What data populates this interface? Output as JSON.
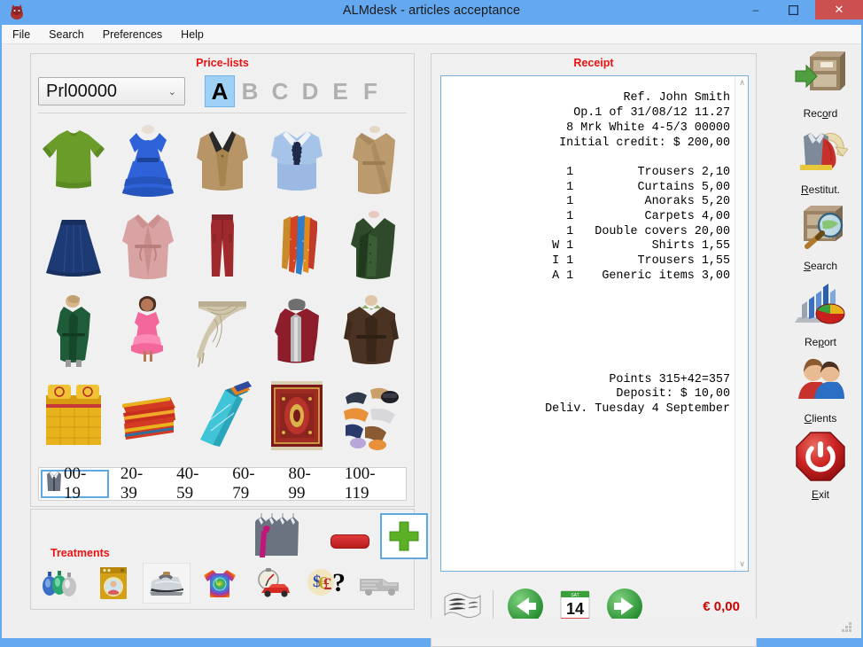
{
  "window": {
    "title": "ALMdesk - articles acceptance",
    "logo_icon": "almdesk-logo-icon",
    "minimize": "–",
    "maximize": "❐",
    "close": "✕",
    "titlebar_color": "#64a8f0",
    "close_color": "#cd5050"
  },
  "menubar": {
    "items": [
      {
        "label": "File"
      },
      {
        "label": "Search"
      },
      {
        "label": "Preferences"
      },
      {
        "label": "Help"
      }
    ]
  },
  "pricelists": {
    "title": "Price-lists",
    "title_color": "#ee1111",
    "combo_value": "Prl00000",
    "combo_arrow": "⌄",
    "letters": [
      "A",
      "B",
      "C",
      "D",
      "E",
      "F"
    ],
    "active_letter": "A",
    "articles": [
      {
        "name": "sweatshirt-green",
        "label": "Sweatshirt"
      },
      {
        "name": "dress-blue",
        "label": "Dress"
      },
      {
        "name": "jacket-tan",
        "label": "Jacket"
      },
      {
        "name": "shirt-blue-with-tie",
        "label": "Shirt"
      },
      {
        "name": "coat-camel",
        "label": "Coat"
      },
      {
        "name": "skirt-navy",
        "label": "Skirt"
      },
      {
        "name": "robe-pink",
        "label": "Robe"
      },
      {
        "name": "trousers-red",
        "label": "Trousers"
      },
      {
        "name": "ties-assorted",
        "label": "Ties"
      },
      {
        "name": "jacket-green",
        "label": "Jacket"
      },
      {
        "name": "raincoat-green",
        "label": "Raincoat"
      },
      {
        "name": "child-dress-pink",
        "label": "Child dress"
      },
      {
        "name": "curtain-beige",
        "label": "Curtains"
      },
      {
        "name": "anorak-red",
        "label": "Anoraks"
      },
      {
        "name": "leather-coat-brown",
        "label": "Leather coat"
      },
      {
        "name": "bed-covers-yellow",
        "label": "Double covers"
      },
      {
        "name": "blankets-red-folded",
        "label": "Blankets"
      },
      {
        "name": "towels-turquoise",
        "label": "Towels"
      },
      {
        "name": "carpet-persian",
        "label": "Carpets"
      },
      {
        "name": "accessories-assorted",
        "label": "Generic items"
      }
    ],
    "ranges": [
      {
        "label": "00-19",
        "icon": "suit-icon",
        "active": true
      },
      {
        "label": "20-39",
        "active": false
      },
      {
        "label": "40-59",
        "active": false
      },
      {
        "label": "60-79",
        "active": false
      },
      {
        "label": "80-99",
        "active": false
      },
      {
        "label": "100-119",
        "active": false
      }
    ]
  },
  "treatments": {
    "label": "Treatments",
    "label_color": "#ee1111",
    "suits_icon": "suits-rack-icon",
    "minus_label": "−",
    "plus_label": "+",
    "items": [
      {
        "name": "dyeing-icon",
        "label": "Dyeing"
      },
      {
        "name": "washing-machine-icon",
        "label": "Washing"
      },
      {
        "name": "ironing-icon",
        "label": "Ironing"
      },
      {
        "name": "tie-dye-shirt-icon",
        "label": "Colour"
      },
      {
        "name": "express-timer-icon",
        "label": "Express"
      },
      {
        "name": "currency-question-icon",
        "label": "Price query"
      },
      {
        "name": "delivery-van-icon",
        "label": "Delivery"
      }
    ]
  },
  "receipt": {
    "title": "Receipt",
    "title_color": "#ee1111",
    "header": [
      "Ref. John Smith",
      "Op.1 of 31/08/12 11.27",
      "8 Mrk White 4-5/3 00000",
      "Initial credit: $ 200,00"
    ],
    "lines": [
      {
        "flag": "",
        "qty": "1",
        "item": "Trousers",
        "price": "2,10"
      },
      {
        "flag": "",
        "qty": "1",
        "item": "Curtains",
        "price": "5,00"
      },
      {
        "flag": "",
        "qty": "1",
        "item": "Anoraks",
        "price": "5,20"
      },
      {
        "flag": "",
        "qty": "1",
        "item": "Carpets",
        "price": "4,00"
      },
      {
        "flag": "",
        "qty": "1",
        "item": "Double covers",
        "price": "20,00"
      },
      {
        "flag": "W",
        "qty": "1",
        "item": "Shirts",
        "price": "1,55"
      },
      {
        "flag": "I",
        "qty": "1",
        "item": "Trousers",
        "price": "1,55"
      },
      {
        "flag": "A",
        "qty": "1",
        "item": "Generic items",
        "price": "3,00"
      }
    ],
    "footer": [
      "Points 315+42=357",
      "Deposit: $ 10,00",
      "Deliv. Tuesday 4 September"
    ],
    "scroll_up": "∧",
    "scroll_down": "∨",
    "toolbar": {
      "receipt_icon": "receipt-ticket-icon",
      "prev_icon": "arrow-left-icon",
      "calendar_icon": "calendar-icon",
      "calendar_day": "14",
      "calendar_month": "SAT",
      "next_icon": "arrow-right-icon",
      "total": "€ 0,00",
      "total_color": "#cc0000"
    }
  },
  "sidebar": {
    "items": [
      {
        "name": "record",
        "label": "Record",
        "accesskey": "o",
        "icon": "filing-cabinet-in-icon"
      },
      {
        "name": "restitution",
        "label": "Restitut.",
        "accesskey": "R",
        "icon": "garments-return-icon"
      },
      {
        "name": "search",
        "label": "Search",
        "accesskey": "S",
        "icon": "cabinet-magnifier-icon"
      },
      {
        "name": "report",
        "label": "Report",
        "accesskey": "p",
        "icon": "bar-pie-chart-icon"
      },
      {
        "name": "clients",
        "label": "Clients",
        "accesskey": "C",
        "icon": "people-icon"
      },
      {
        "name": "exit",
        "label": "Exit",
        "accesskey": "E",
        "icon": "power-off-icon"
      }
    ]
  }
}
